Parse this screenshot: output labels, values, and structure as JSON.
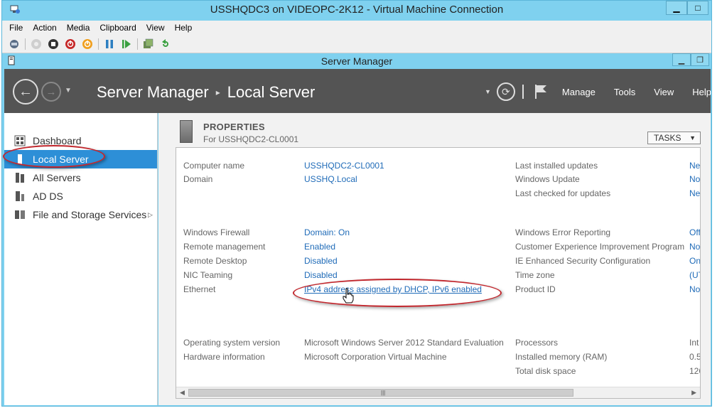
{
  "window": {
    "title": "USSHQDC3 on VIDEOPC-2K12 - Virtual Machine Connection",
    "controls": [
      "minimize",
      "maximize"
    ]
  },
  "vm_menu": [
    "File",
    "Action",
    "Media",
    "Clipboard",
    "View",
    "Help"
  ],
  "vm_toolbar": [
    "ctrl-alt-del-icon",
    "start-icon",
    "turn-off-icon",
    "shutdown-icon",
    "save-icon",
    "pause-icon",
    "resume-icon",
    "snapshot-icon",
    "revert-icon"
  ],
  "server_manager": {
    "title": "Server Manager",
    "breadcrumb": [
      "Server Manager",
      "Local Server"
    ],
    "header_menu": [
      "Manage",
      "Tools",
      "View",
      "Help"
    ]
  },
  "sidebar": {
    "items": [
      {
        "label": "Dashboard",
        "icon": "dashboard-icon",
        "active": false
      },
      {
        "label": "Local Server",
        "icon": "local-server-icon",
        "active": true
      },
      {
        "label": "All Servers",
        "icon": "all-servers-icon",
        "active": false
      },
      {
        "label": "AD DS",
        "icon": "ad-ds-icon",
        "active": false
      },
      {
        "label": "File and Storage Services",
        "icon": "storage-icon",
        "active": false,
        "has_submenu": true
      }
    ]
  },
  "properties": {
    "title": "PROPERTIES",
    "subtitle": "For USSHQDC2-CL0001",
    "tasks_label": "TASKS",
    "left": [
      {
        "label": "Computer name",
        "value": "USSHQDC2-CL0001",
        "link": true
      },
      {
        "label": "Domain",
        "value": "USSHQ.Local",
        "link": true
      },
      {
        "label": "Windows Firewall",
        "value": "Domain: On",
        "link": true
      },
      {
        "label": "Remote management",
        "value": "Enabled",
        "link": true
      },
      {
        "label": "Remote Desktop",
        "value": "Disabled",
        "link": true
      },
      {
        "label": "NIC Teaming",
        "value": "Disabled",
        "link": true
      },
      {
        "label": "Ethernet",
        "value": "IPv4 address assigned by DHCP, IPv6 enabled",
        "link": true
      },
      {
        "label": "Operating system version",
        "value": "Microsoft Windows Server 2012 Standard Evaluation",
        "link": false
      },
      {
        "label": "Hardware information",
        "value": "Microsoft Corporation Virtual Machine",
        "link": false
      }
    ],
    "right": [
      {
        "label": "Last installed updates",
        "value": "Ne",
        "link": true
      },
      {
        "label": "Windows Update",
        "value": "No",
        "link": true
      },
      {
        "label": "Last checked for updates",
        "value": "Ne",
        "link": true
      },
      {
        "label": "Windows Error Reporting",
        "value": "Off",
        "link": true
      },
      {
        "label": "Customer Experience Improvement Program",
        "value": "No",
        "link": true
      },
      {
        "label": "IE Enhanced Security Configuration",
        "value": "On",
        "link": true
      },
      {
        "label": "Time zone",
        "value": "(UT",
        "link": true
      },
      {
        "label": "Product ID",
        "value": "No",
        "link": true
      },
      {
        "label": "Processors",
        "value": "Int",
        "link": false
      },
      {
        "label": "Installed memory (RAM)",
        "value": "0.5",
        "link": false
      },
      {
        "label": "Total disk space",
        "value": "126",
        "link": false
      }
    ]
  },
  "colors": {
    "title_bar": "#7fd1ef",
    "header_bg": "#545454",
    "active_item": "#2d8fd7",
    "link": "#1f6bb8",
    "highlight_oval": "#c1272d"
  }
}
